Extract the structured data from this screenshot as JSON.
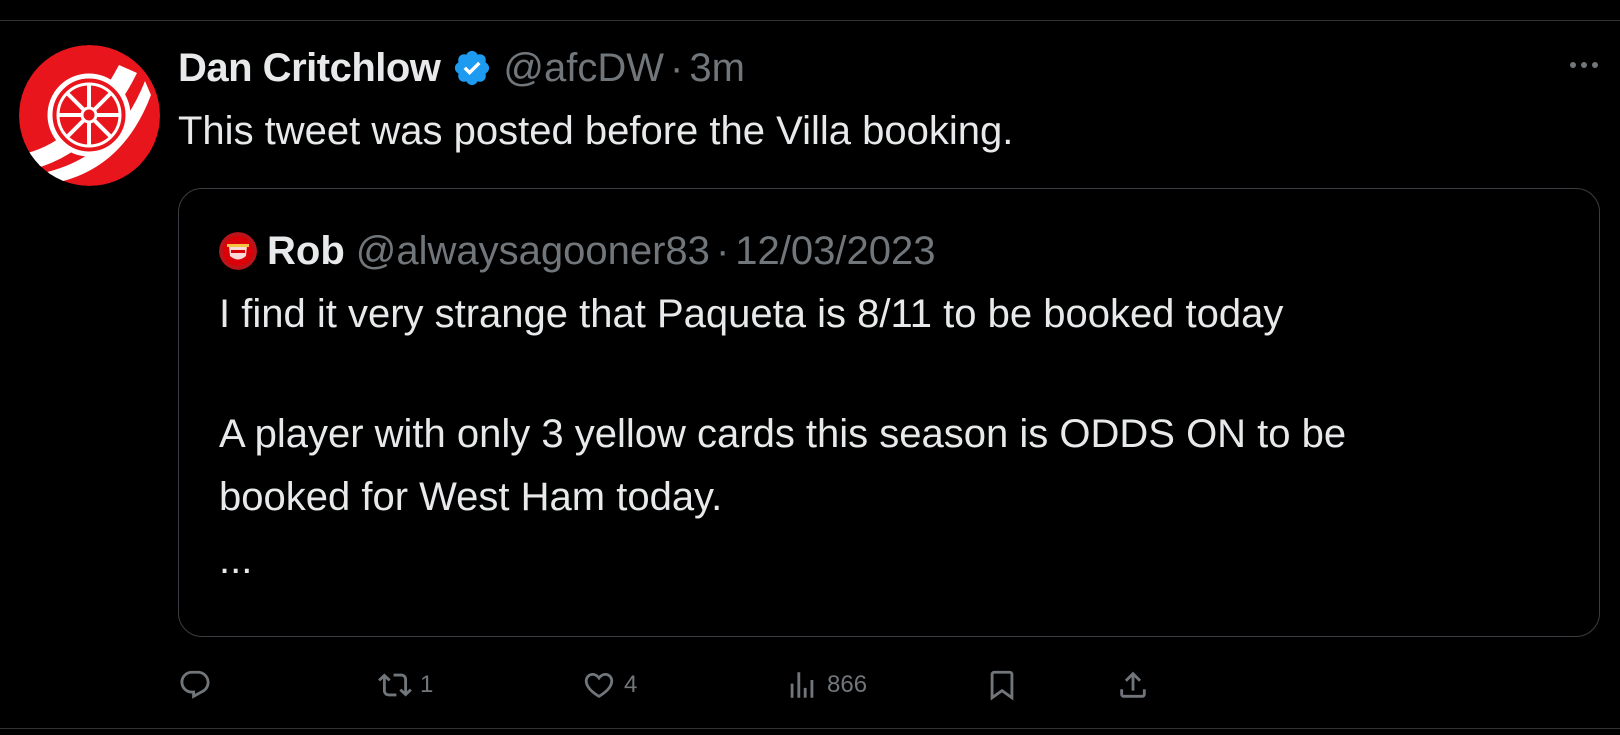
{
  "tweet": {
    "display_name": "Dan Critchlow",
    "handle": "@afcDW",
    "separator": "·",
    "time": "3m",
    "text": "This tweet was posted before the Villa booking.",
    "verified_color": "#1d9bf0",
    "avatar_icon": "cannon-wheel-icon"
  },
  "quoted": {
    "display_name": "Rob",
    "handle": "@alwaysagooner83",
    "separator": "·",
    "date": "12/03/2023",
    "avatar_icon": "arsenal-crest-icon",
    "lines": [
      "I find it very strange that Paqueta is 8/11 to be booked today",
      "A player with only 3 yellow cards this season is ODDS ON to be",
      "booked for West Ham today.",
      "..."
    ]
  },
  "actions": {
    "reply": {
      "icon": "reply-icon",
      "count": ""
    },
    "retweet": {
      "icon": "retweet-icon",
      "count": "1"
    },
    "like": {
      "icon": "heart-icon",
      "count": "4"
    },
    "views": {
      "icon": "views-icon",
      "count": "866"
    },
    "bookmark": {
      "icon": "bookmark-icon"
    },
    "share": {
      "icon": "share-icon"
    }
  },
  "colors": {
    "background": "#000000",
    "text_primary": "#e7e9ea",
    "text_secondary": "#71767b",
    "border": "#3a3d41",
    "avatar_red": "#e8161c"
  }
}
